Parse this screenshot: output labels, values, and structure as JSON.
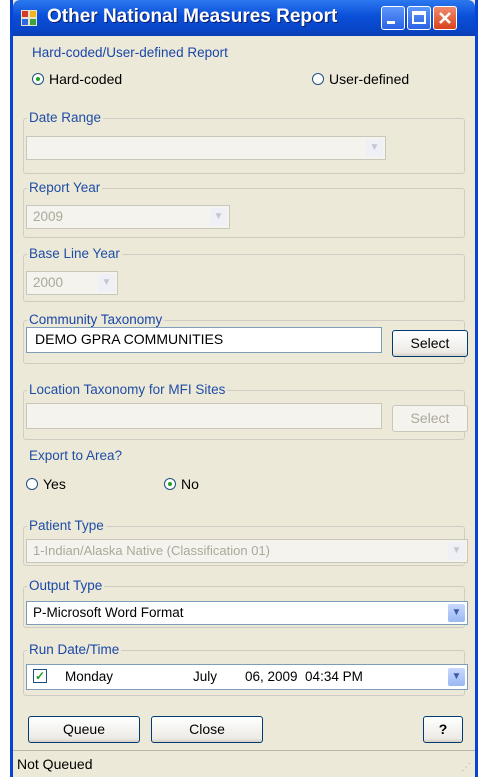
{
  "window": {
    "title": "Other National Measures Report"
  },
  "report_mode": {
    "label": "Hard-coded/User-defined Report",
    "options": [
      {
        "label": "Hard-coded",
        "selected": true
      },
      {
        "label": "User-defined",
        "selected": false
      }
    ]
  },
  "date_range": {
    "label": "Date Range",
    "value": ""
  },
  "report_year": {
    "label": "Report Year",
    "value": "2009"
  },
  "baseline_year": {
    "label": "Base Line Year",
    "value": "2000"
  },
  "community_taxonomy": {
    "label": "Community Taxonomy",
    "value": "DEMO GPRA COMMUNITIES",
    "button": "Select"
  },
  "location_taxonomy": {
    "label": "Location Taxonomy for MFI Sites",
    "value": "",
    "button": "Select"
  },
  "export_area": {
    "label": "Export to Area?",
    "options": [
      {
        "label": "Yes",
        "selected": false
      },
      {
        "label": "No",
        "selected": true
      }
    ]
  },
  "patient_type": {
    "label": "Patient Type",
    "value": "1-Indian/Alaska Native (Classification 01)"
  },
  "output_type": {
    "label": "Output Type",
    "value": "P-Microsoft Word Format"
  },
  "run_datetime": {
    "label": "Run Date/Time",
    "checked": true,
    "day": "Monday",
    "month": "July",
    "date_time": "06, 2009  04:34 PM"
  },
  "buttons": {
    "queue": "Queue",
    "close": "Close",
    "help": "?"
  },
  "status": {
    "text": "Not Queued"
  }
}
